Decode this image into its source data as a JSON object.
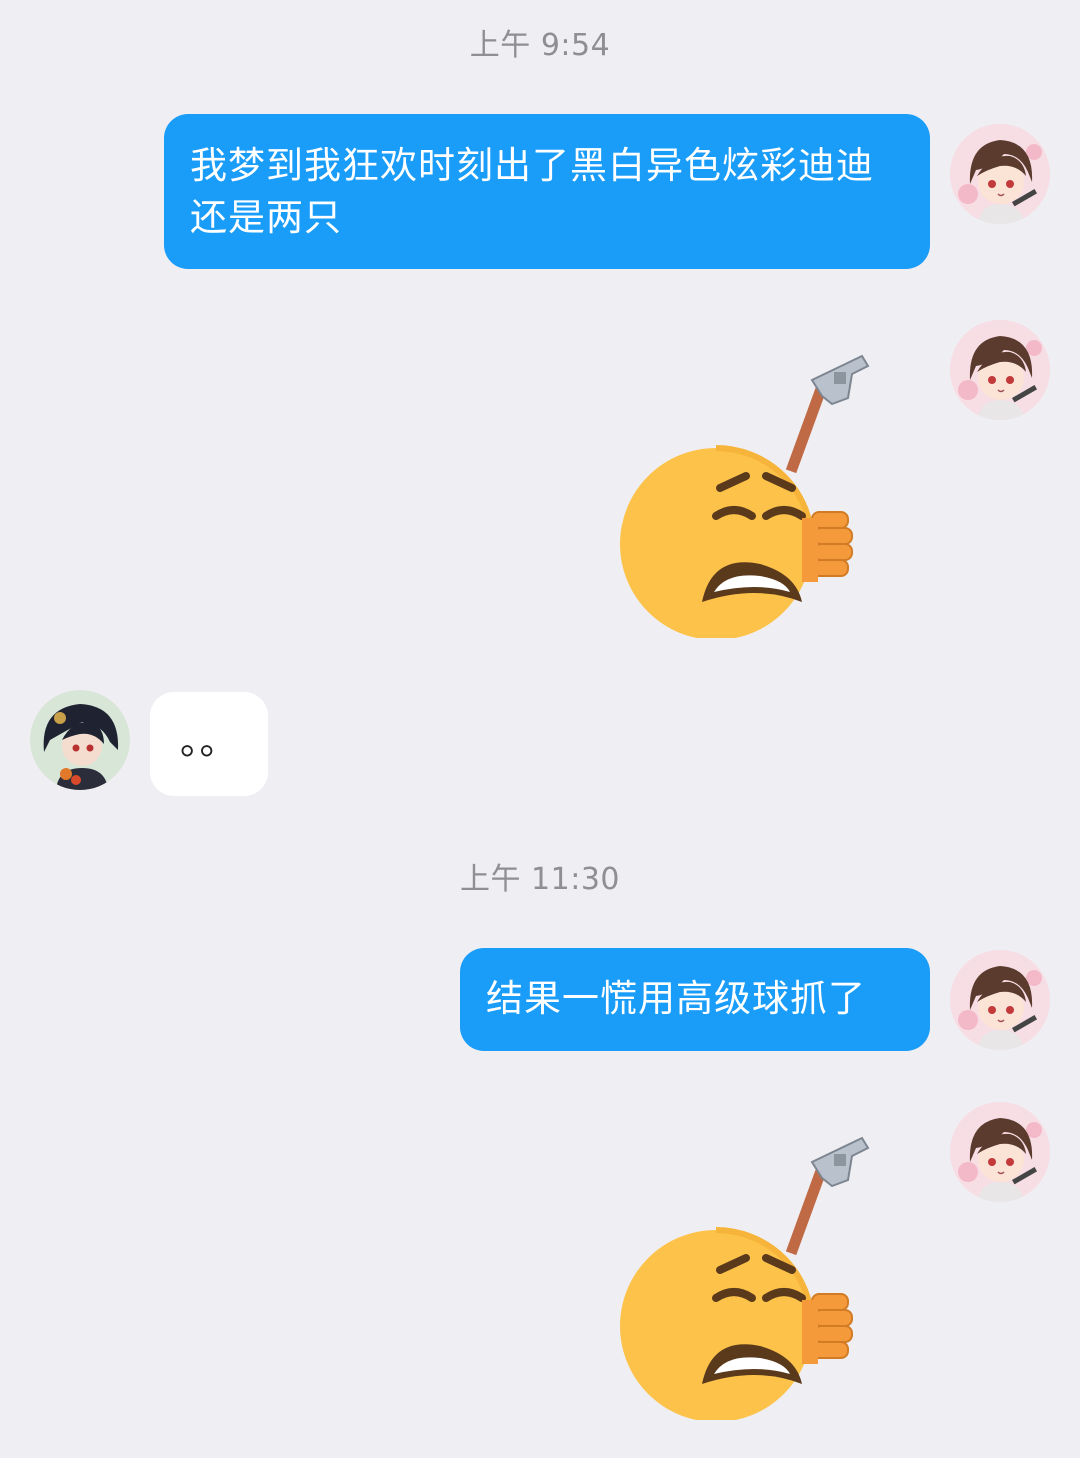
{
  "conversation": {
    "colors": {
      "outgoing_bubble": "#1a9cf9",
      "incoming_bubble": "#ffffff",
      "background": "#efeff3",
      "timestamp": "#8e8e93"
    },
    "groups": [
      {
        "timestamp": "上午 9:54"
      },
      {
        "timestamp": "上午 11:30"
      }
    ],
    "messages": [
      {
        "sender": "me",
        "type": "text",
        "text": "我梦到我狂欢时刻出了黑白异色炫彩迪迪 还是两只"
      },
      {
        "sender": "me",
        "type": "sticker",
        "sticker": "sad-face-with-gun-sticker"
      },
      {
        "sender": "other",
        "type": "text",
        "text": "。。"
      },
      {
        "sender": "me",
        "type": "text",
        "text": "结果一慌用高级球抓了"
      },
      {
        "sender": "me",
        "type": "sticker",
        "sticker": "sad-face-with-gun-sticker"
      }
    ]
  }
}
